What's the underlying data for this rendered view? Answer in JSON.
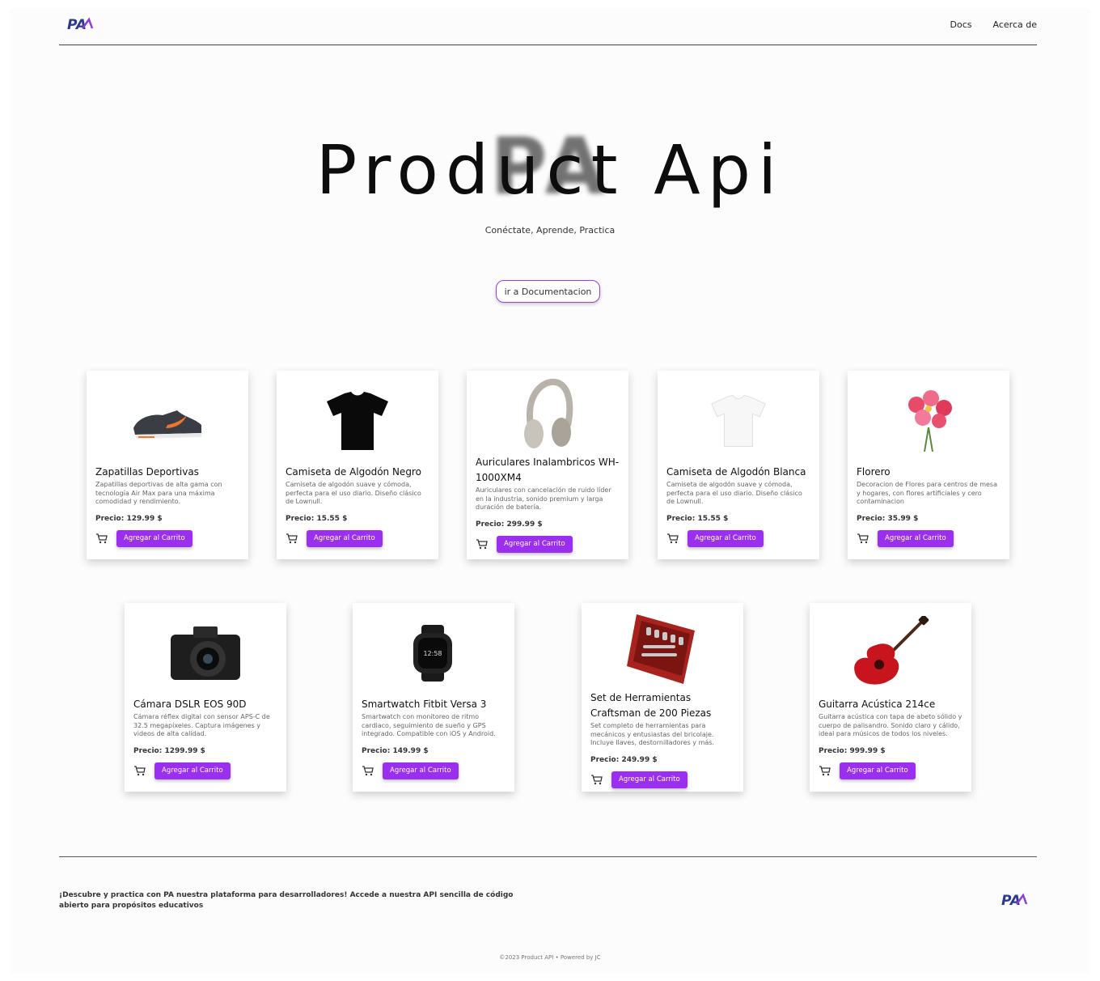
{
  "header": {
    "logo_text": "PA",
    "nav": [
      "Docs",
      "Acerca de"
    ]
  },
  "hero": {
    "ghost_text": "PA",
    "title": "Product Api",
    "subtitle": "Conéctate, Aprende, Practica",
    "button_label": "ir a Documentacion"
  },
  "products": [
    {
      "title": "Zapatillas Deportivas",
      "description": "Zapatillas deportivas de alta gama con tecnología Air Max para una máxima comodidad y rendimiento.",
      "price": "Precio: 129.99 $",
      "button": "Agregar al Carrito",
      "image_icon": "sneaker-icon"
    },
    {
      "title": "Camiseta de Algodón Negro",
      "description": "Camiseta de algodón suave y cómoda, perfecta para el uso diario. Diseño clásico de Lownull.",
      "price": "Precio: 15.55 $",
      "button": "Agregar al Carrito",
      "image_icon": "black-tshirt-icon"
    },
    {
      "title": "Auriculares Inalambricos WH-1000XM4",
      "description": "Auriculares con cancelación de ruido líder en la industria, sonido premium y larga duración de batería.",
      "price": "Precio: 299.99 $",
      "button": "Agregar al Carrito",
      "image_icon": "headphones-icon"
    },
    {
      "title": "Camiseta de Algodón Blanca",
      "description": "Camiseta de algodón suave y cómoda, perfecta para el uso diario. Diseño clásico de Lownull.",
      "price": "Precio: 15.55 $",
      "button": "Agregar al Carrito",
      "image_icon": "white-tshirt-icon"
    },
    {
      "title": "Florero",
      "description": "Decoracion de Flores para centros de mesa y hogares, con flores artificiales y cero contaminacion",
      "price": "Precio: 35.99 $",
      "button": "Agregar al Carrito",
      "image_icon": "flowers-icon"
    },
    {
      "title": "Cámara DSLR EOS 90D",
      "description": "Cámara réflex digital con sensor APS-C de 32.5 megapíxeles. Captura imágenes y videos de alta calidad.",
      "price": "Precio: 1299.99 $",
      "button": "Agregar al Carrito",
      "image_icon": "camera-icon"
    },
    {
      "title": "Smartwatch Fitbit Versa 3",
      "description": "Smartwatch con monitoreo de ritmo cardiaco, seguimiento de sueño y GPS integrado. Compatible con iOS y Android.",
      "price": "Precio: 149.99 $",
      "button": "Agregar al Carrito",
      "image_icon": "smartwatch-icon"
    },
    {
      "title": "Set de Herramientas Craftsman de 200 Piezas",
      "description": "Set completo de herramientas para mecánicos y entusiastas del bricolaje. Incluye llaves, destornilladores y más.",
      "price": "Precio: 249.99 $",
      "button": "Agregar al Carrito",
      "image_icon": "toolset-icon"
    },
    {
      "title": "Guitarra Acústica 214ce",
      "description": "Guitarra acústica con tapa de abeto sólido y cuerpo de palisandro. Sonido claro y cálido, ideal para músicos de todos los niveles.",
      "price": "Precio: 999.99 $",
      "button": "Agregar al Carrito",
      "image_icon": "guitar-icon"
    }
  ],
  "footer": {
    "text": "¡Descubre y practica con PA nuestra plataforma para desarrolladores! Accede a nuestra API sencilla de código abierto para propósitos educativos",
    "logo_text": "PA",
    "copyright": "©2023 Product API  •  Powered by JC"
  },
  "colors": {
    "accent": "#9b2ff0",
    "logo_blue": "#2b3a8f",
    "logo_purple": "#8a3fd8"
  }
}
